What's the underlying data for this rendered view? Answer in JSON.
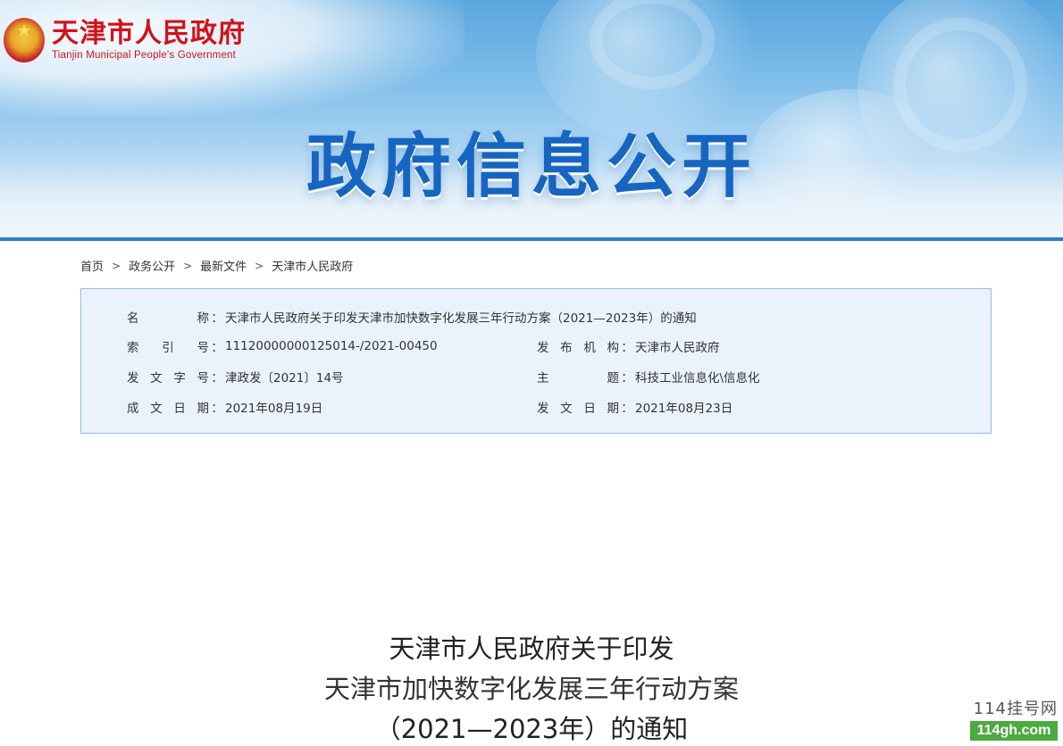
{
  "site": {
    "name_cn": "天津市人民政府",
    "name_en": "Tianjin Municipal People's Government",
    "banner_title": "政府信息公开"
  },
  "breadcrumb": [
    {
      "label": "首页"
    },
    {
      "label": "政务公开"
    },
    {
      "label": "最新文件"
    },
    {
      "label": "天津市人民政府"
    }
  ],
  "meta": {
    "name_label": "名称",
    "name_value": "天津市人民政府关于印发天津市加快数字化发展三年行动方案（2021—2023年）的通知",
    "index_label": "索引号",
    "index_value": "11120000000125014-/2021-00450",
    "issuer_label": "发布机构",
    "issuer_value": "天津市人民政府",
    "doc_no_label": "发文字号",
    "doc_no_value": "津政发〔2021〕14号",
    "subject_label": "主题",
    "subject_value": "科技工业信息化\\信息化",
    "created_label": "成文日期",
    "created_value": "2021年08月19日",
    "published_label": "发文日期",
    "published_value": "2021年08月23日"
  },
  "document": {
    "title_line1": "天津市人民政府关于印发",
    "title_line2": "天津市加快数字化发展三年行动方案",
    "title_line3": "（2021—2023年）的通知"
  },
  "watermark": {
    "top": "114挂号网",
    "bottom": "114gh.com"
  },
  "colors": {
    "brand_red": "#d2121b",
    "title_blue": "#1665c1",
    "meta_bg": "#eaf3fc",
    "meta_border": "#8fbde6"
  }
}
